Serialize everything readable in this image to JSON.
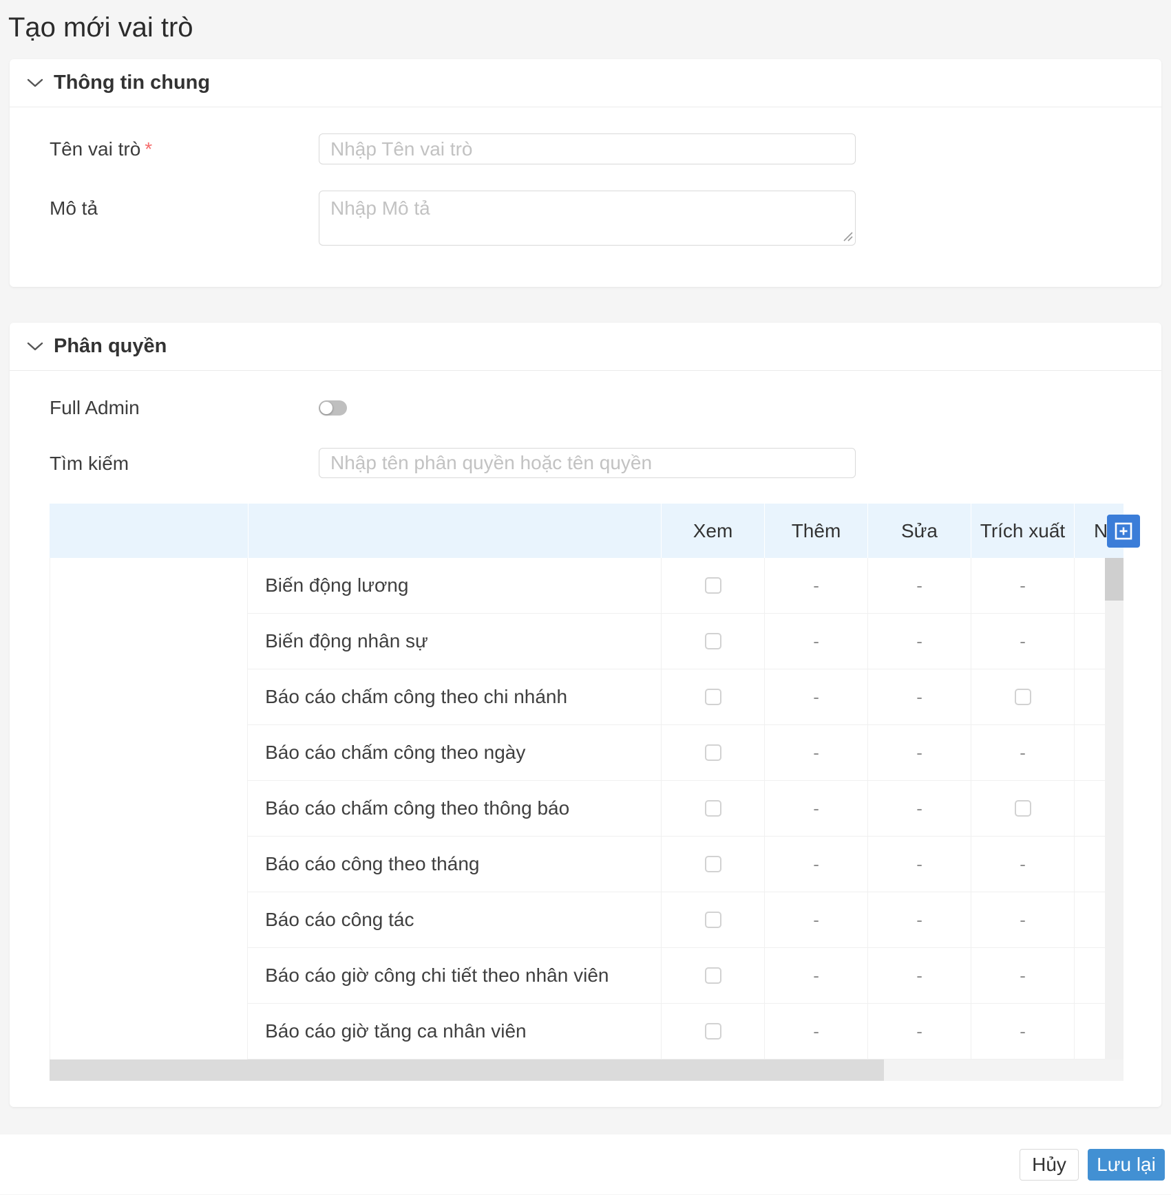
{
  "page": {
    "title": "Tạo mới vai trò"
  },
  "general_section": {
    "title": "Thông tin chung",
    "fields": [
      {
        "label": "Tên vai trò",
        "required_mark": "*",
        "placeholder": "Nhập Tên vai trò",
        "value": ""
      },
      {
        "label": "Mô tả",
        "placeholder": "Nhập Mô tả",
        "value": ""
      }
    ]
  },
  "permission_section": {
    "title": "Phân quyền",
    "full_admin_label": "Full Admin",
    "full_admin_state": "off",
    "search_label": "Tìm kiếm",
    "search_placeholder": "Nhập tên phân quyền hoặc tên quyền",
    "search_value": "",
    "table": {
      "columns": [
        "Xem",
        "Thêm",
        "Sửa",
        "Trích xuất",
        "N"
      ],
      "dash": "-",
      "rows": [
        {
          "name": "Biến động lương",
          "cells": [
            "checkbox",
            "dash",
            "dash",
            "dash"
          ]
        },
        {
          "name": "Biến động nhân sự",
          "cells": [
            "checkbox",
            "dash",
            "dash",
            "dash"
          ]
        },
        {
          "name": "Báo cáo chấm công theo chi nhánh",
          "cells": [
            "checkbox",
            "dash",
            "dash",
            "checkbox"
          ]
        },
        {
          "name": "Báo cáo chấm công theo ngày",
          "cells": [
            "checkbox",
            "dash",
            "dash",
            "dash"
          ]
        },
        {
          "name": "Báo cáo chấm công theo thông báo",
          "cells": [
            "checkbox",
            "dash",
            "dash",
            "checkbox"
          ]
        },
        {
          "name": "Báo cáo công theo tháng",
          "cells": [
            "checkbox",
            "dash",
            "dash",
            "dash"
          ]
        },
        {
          "name": "Báo cáo công tác",
          "cells": [
            "checkbox",
            "dash",
            "dash",
            "dash"
          ]
        },
        {
          "name": "Báo cáo giờ công chi tiết theo nhân viên",
          "cells": [
            "checkbox",
            "dash",
            "dash",
            "dash"
          ]
        },
        {
          "name": "Báo cáo giờ tăng ca nhân viên",
          "cells": [
            "checkbox",
            "dash",
            "dash",
            "dash"
          ]
        }
      ]
    }
  },
  "footer": {
    "cancel_label": "Hủy",
    "save_label": "Lưu lại"
  },
  "colors": {
    "save_button_blue": "#4290d3",
    "add_button_blue": "#3b7dd8",
    "table_header_bg": "#e9f4fd",
    "required_red": "#f56c6c"
  }
}
